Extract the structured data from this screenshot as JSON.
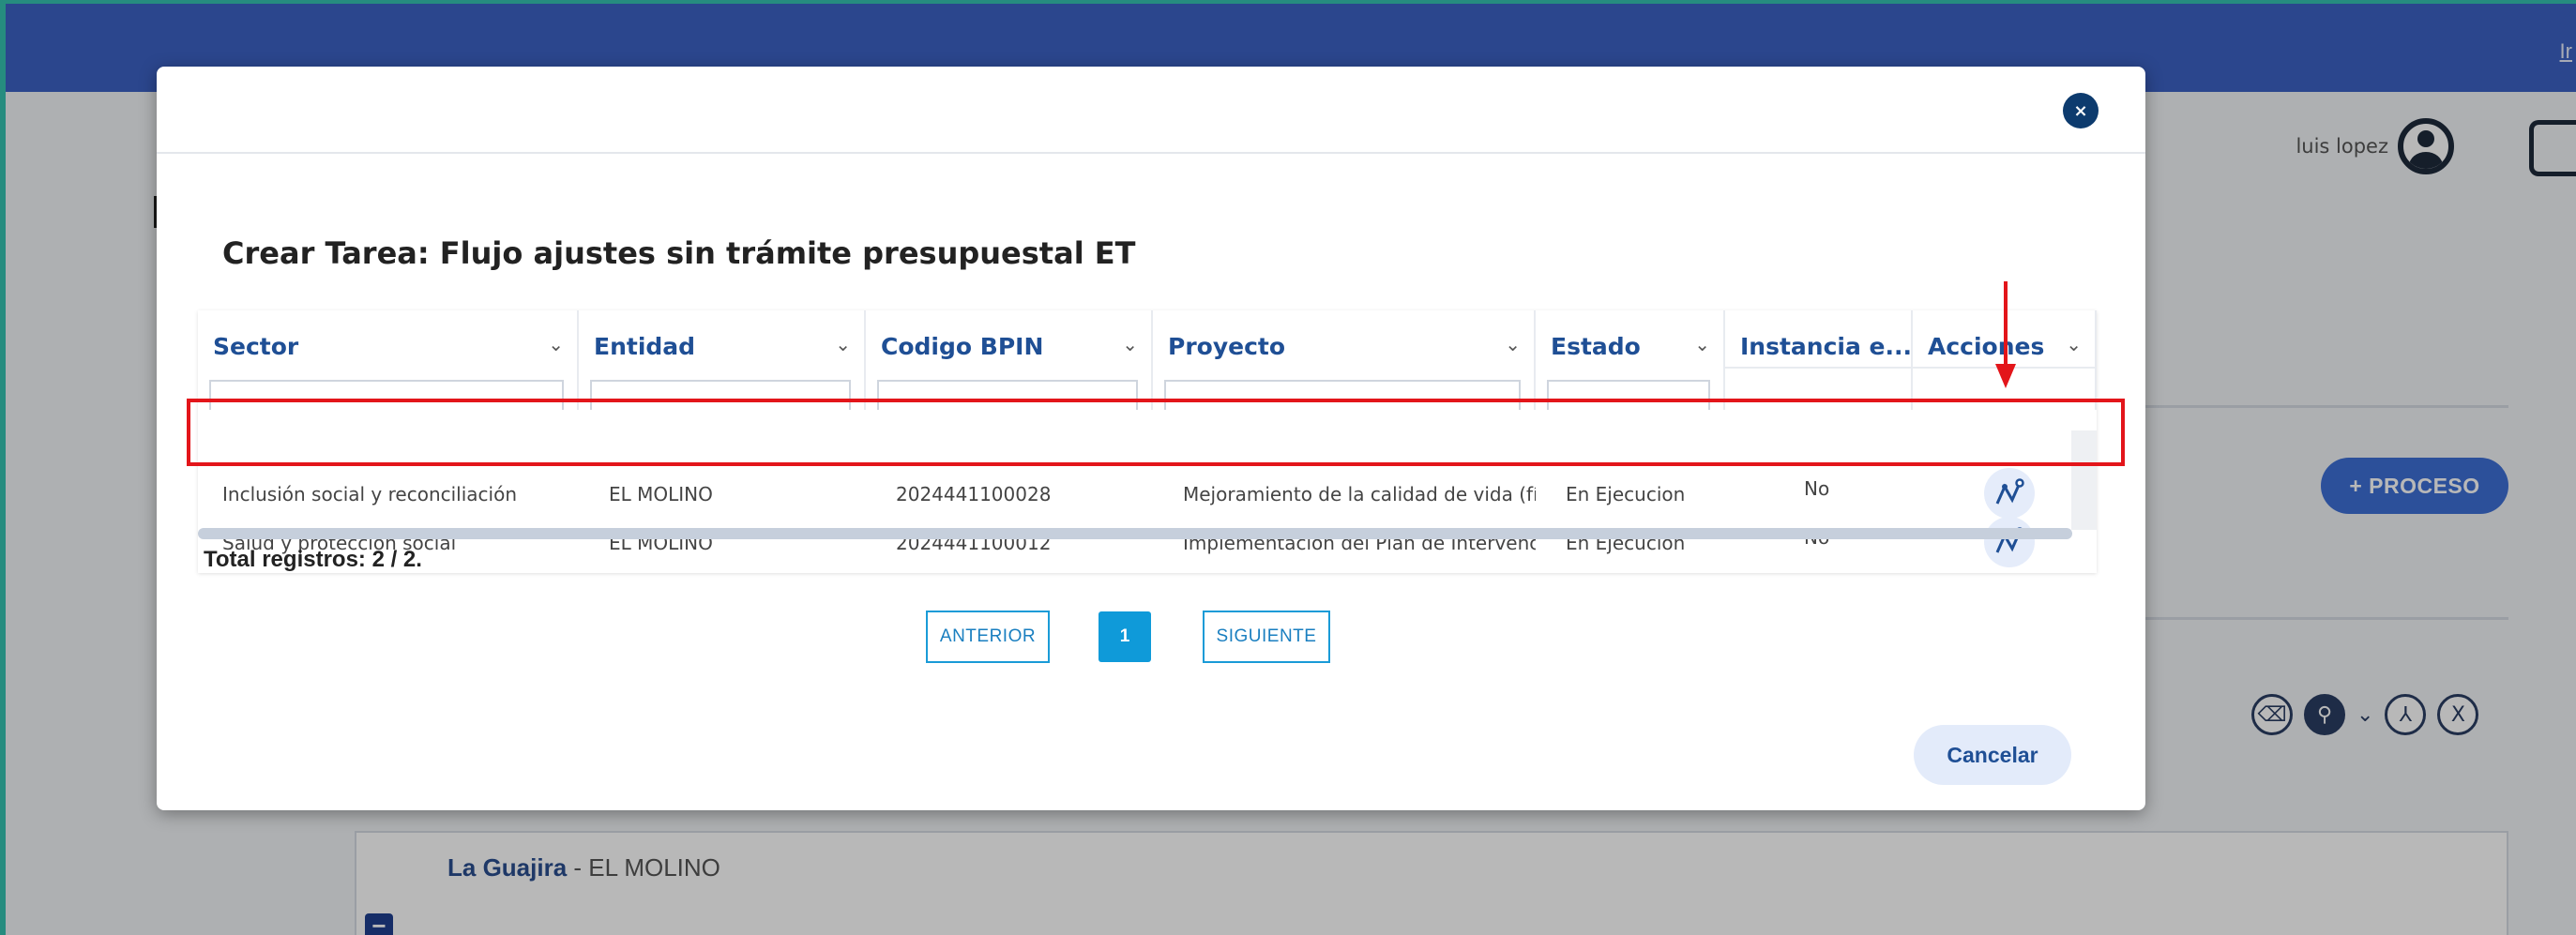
{
  "topbar": {
    "link": "Ir"
  },
  "user": {
    "name": "luis lopez"
  },
  "background": {
    "proceso_label": "+ PROCESO",
    "region_name": "La Guajira",
    "region_separator": " - ",
    "region_entity": "EL MOLINO",
    "collapse_label": "−"
  },
  "modal": {
    "close_label": "×",
    "title": "Crear Tarea: Flujo ajustes sin trámite presupuestal ET",
    "columns": [
      {
        "label": "Sector"
      },
      {
        "label": "Entidad"
      },
      {
        "label": "Codigo BPIN"
      },
      {
        "label": "Proyecto"
      },
      {
        "label": "Estado"
      },
      {
        "label": "Instancia e..."
      },
      {
        "label": "Acciones"
      }
    ],
    "rows": [
      {
        "sector": "Inclusión social y reconciliación",
        "entidad": "EL MOLINO",
        "bpin": "2024441100028",
        "proyecto": "Mejoramiento de la calidad de vida (físi",
        "estado": "En Ejecucion",
        "instancia": "No"
      },
      {
        "sector": "Salud y protección social",
        "entidad": "EL MOLINO",
        "bpin": "2024441100012",
        "proyecto": "Implementación del Plan de Intervenc",
        "estado": "En Ejecucion",
        "instancia": "No"
      }
    ],
    "total_label": "Total registros: 2 / 2.",
    "pager": {
      "prev": "ANTERIOR",
      "page": "1",
      "next": "SIGUIENTE"
    },
    "cancel_label": "Cancelar"
  },
  "icons": {
    "action": "workflow-icon",
    "tools": [
      "eraser-icon",
      "search-icon",
      "pdf-icon",
      "excel-icon"
    ]
  },
  "colors": {
    "topbar": "#3c62c4",
    "header_text": "#1f4f95",
    "highlight": "#e3151a",
    "page_active": "#0f9ad9"
  }
}
